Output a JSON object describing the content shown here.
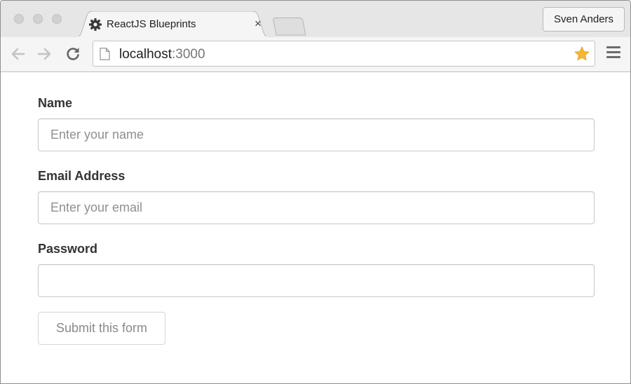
{
  "browser": {
    "tab": {
      "title": "ReactJS Blueprints",
      "icon": "gear-icon",
      "close_glyph": "×"
    },
    "profile": {
      "name": "Sven Anders"
    },
    "address_bar": {
      "host": "localhost",
      "port": ":3000",
      "star_color": "#f5b731"
    }
  },
  "form": {
    "name": {
      "label": "Name",
      "placeholder": "Enter your name",
      "value": ""
    },
    "email": {
      "label": "Email Address",
      "placeholder": "Enter your email",
      "value": ""
    },
    "password": {
      "label": "Password",
      "placeholder": "",
      "value": ""
    },
    "submit_label": "Submit this form"
  }
}
